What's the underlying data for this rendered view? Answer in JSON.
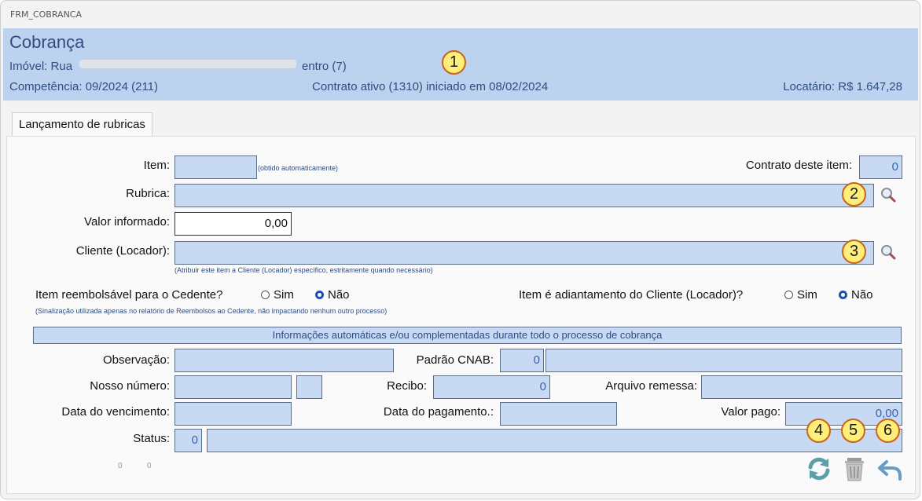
{
  "window": {
    "title": "FRM_COBRANCA"
  },
  "header": {
    "title": "Cobrança",
    "imovel_prefix": "Imóvel: Rua",
    "imovel_suffix": "entro (7)",
    "competencia": "Competência: 09/2024 (211)",
    "contrato": "Contrato ativo (1310) iniciado em 08/02/2024",
    "locatario": "Locatário: R$ 1.647,28"
  },
  "tab": {
    "label": "Lançamento de rubricas"
  },
  "form": {
    "item_label": "Item:",
    "item_note": "(obtido automaticamente)",
    "contrato_item_label": "Contrato deste item:",
    "contrato_item_value": "0",
    "rubrica_label": "Rubrica:",
    "valor_label": "Valor informado:",
    "valor_value": "0,00",
    "cliente_label": "Cliente (Locador):",
    "cliente_note": "(Atribuir este item a Cliente (Locador) específico, estritamente quando necessário)",
    "reembolsavel_label": "Item reembolsável para o Cedente?",
    "reembolsavel_note": "(Sinalização utilizada apenas no relatório de Reembolsos ao Cedente, não impactando nenhum outro processo)",
    "adiantamento_label": "Item é adiantamento do Cliente (Locador)?",
    "sim": "Sim",
    "nao": "Não"
  },
  "auto": {
    "bar_title": "Informações automáticas e/ou complementadas durante todo o processo de cobrança",
    "observacao_label": "Observação:",
    "padrao_cnab_label": "Padrão CNAB:",
    "padrao_cnab_value": "0",
    "nosso_numero_label": "Nosso número:",
    "recibo_label": "Recibo:",
    "recibo_value": "0",
    "arquivo_remessa_label": "Arquivo remessa:",
    "data_vencimento_label": "Data do vencimento:",
    "data_pagamento_label": "Data do pagamento.:",
    "valor_pago_label": "Valor pago:",
    "valor_pago_value": "0,00",
    "status_label": "Status:",
    "status_value": "0"
  },
  "footer": {
    "counter_a": "0",
    "counter_b": "0"
  },
  "badges": {
    "b1": "1",
    "b2": "2",
    "b3": "3",
    "b4": "4",
    "b5": "5",
    "b6": "6"
  },
  "icons": [
    "search-icon",
    "refresh-icon",
    "trash-icon",
    "back-arrow-icon"
  ],
  "colors": {
    "header_bg": "#bcd2ee",
    "field_bg": "#c8d9f4",
    "accent_text": "#2f4d80"
  }
}
